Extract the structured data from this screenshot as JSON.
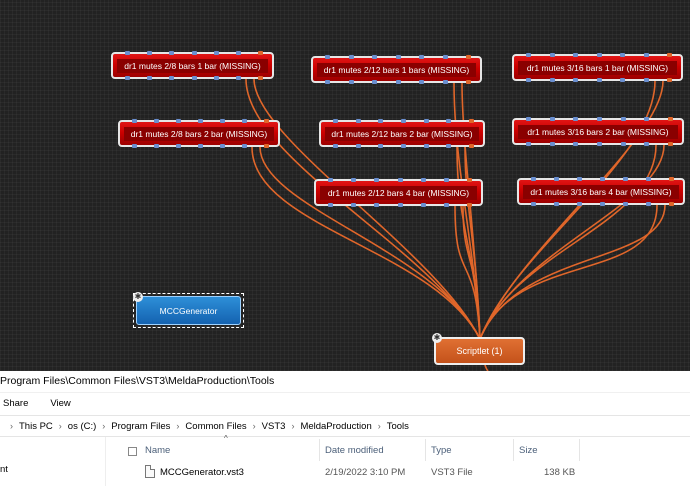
{
  "graph": {
    "node_label_suffix": "(MISSING)",
    "nodes": [
      "dr1 mutes 2/8 bars 1 bar (MISSING)",
      "dr1 mutes 2/12 bars 1 bars (MISSING)",
      "dr1 mutes 3/16 bars 1 bar (MISSING)",
      "dr1 mutes 2/8 bars 2 bar (MISSING)",
      "dr1 mutes 2/12 bars 2 bar (MISSING)",
      "dr1 mutes 3/16 bars 2 bar (MISSING)",
      "dr1 mutes 2/12 bars 4 bar  (MISSING)",
      "dr1 mutes 3/16 bars 4 bar (MISSING)"
    ],
    "mcc_generator": "MCCGenerator",
    "scriptlet": "Scriptlet (1)",
    "colors": {
      "missing_node": "#c00000",
      "wire": "#e0662a",
      "generator": "#1f78c8",
      "scriptlet": "#d9622a",
      "pin_blue": "#6a8fd0"
    }
  },
  "explorer": {
    "title": "Program Files\\Common Files\\VST3\\MeldaProduction\\Tools",
    "ribbon": [
      "Share",
      "View"
    ],
    "breadcrumb": [
      "This PC",
      "os (C:)",
      "Program Files",
      "Common Files",
      "VST3",
      "MeldaProduction",
      "Tools"
    ],
    "nav_item": "nt",
    "columns": {
      "name": "Name",
      "date": "Date modified",
      "type": "Type",
      "size": "Size"
    },
    "files": [
      {
        "name": "MCCGenerator.vst3",
        "date": "2/19/2022 3:10 PM",
        "type": "VST3 File",
        "size": "138 KB",
        "icon": "file-icon"
      }
    ]
  }
}
